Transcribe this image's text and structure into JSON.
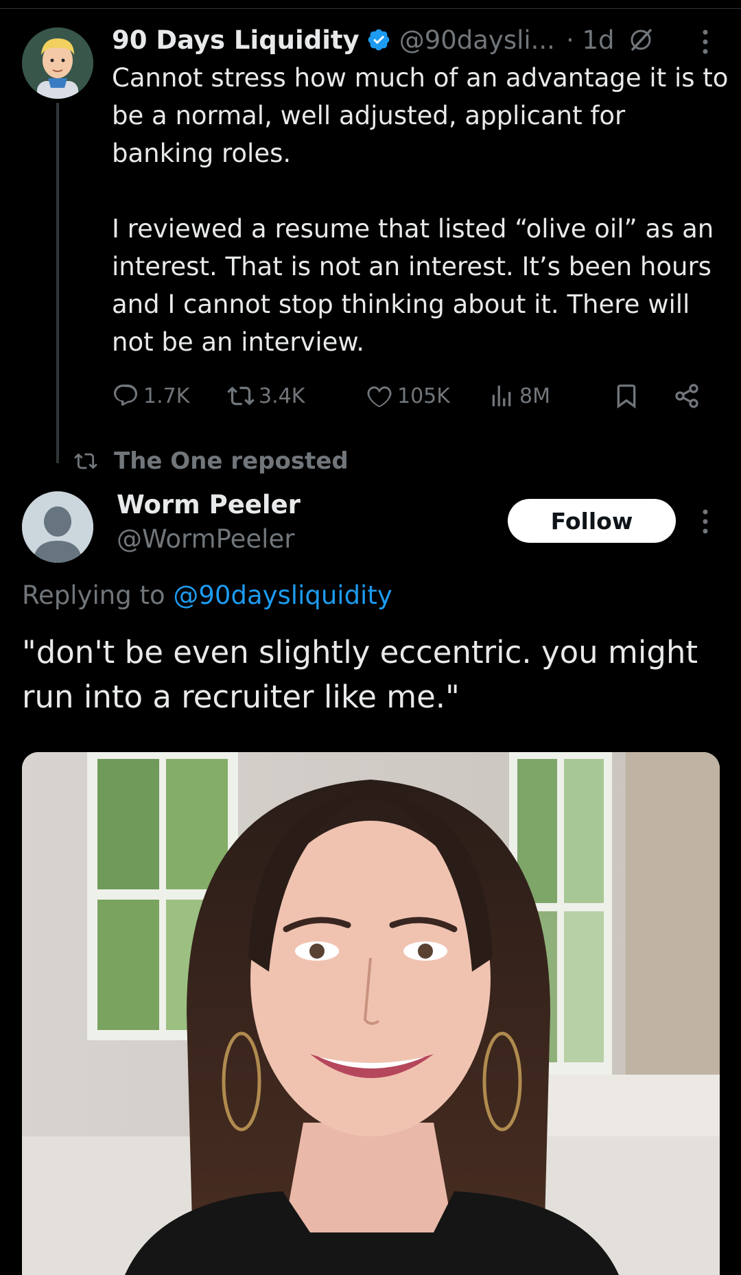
{
  "tweet": {
    "author_name": "90 Days Liquidity",
    "handle": "@90daysli...",
    "time": "· 1d",
    "body_paragraph_1": "Cannot stress how much of an advantage it is to be a normal, well adjusted, applicant for banking roles.",
    "body_paragraph_2": "I reviewed a resume that listed “olive oil” as an interest. That is not an interest. It’s been hours and I cannot stop thinking about it. There will not be an interview.",
    "stats": {
      "replies": "1.7K",
      "reposts": "3.4K",
      "likes": "105K",
      "views": "8M"
    }
  },
  "repost_notice": "The One reposted",
  "reply": {
    "author_name": "Worm Peeler",
    "handle": "@WormPeeler",
    "follow_label": "Follow",
    "replying_prefix": "Replying to",
    "replying_handle": "@90daysliquidity",
    "body": "\"don't be even slightly eccentric. you might run into a recruiter like me.\""
  },
  "colors": {
    "background": "#000000",
    "text_primary": "#e7e9ea",
    "text_secondary": "#71767b",
    "link": "#1d9bf0",
    "verified_badge": "#1d9bf0"
  },
  "icons": [
    "verified-badge-icon",
    "grok-icon",
    "more-options-icon",
    "reply-icon",
    "repost-icon",
    "like-icon",
    "views-icon",
    "bookmark-icon",
    "share-icon"
  ]
}
